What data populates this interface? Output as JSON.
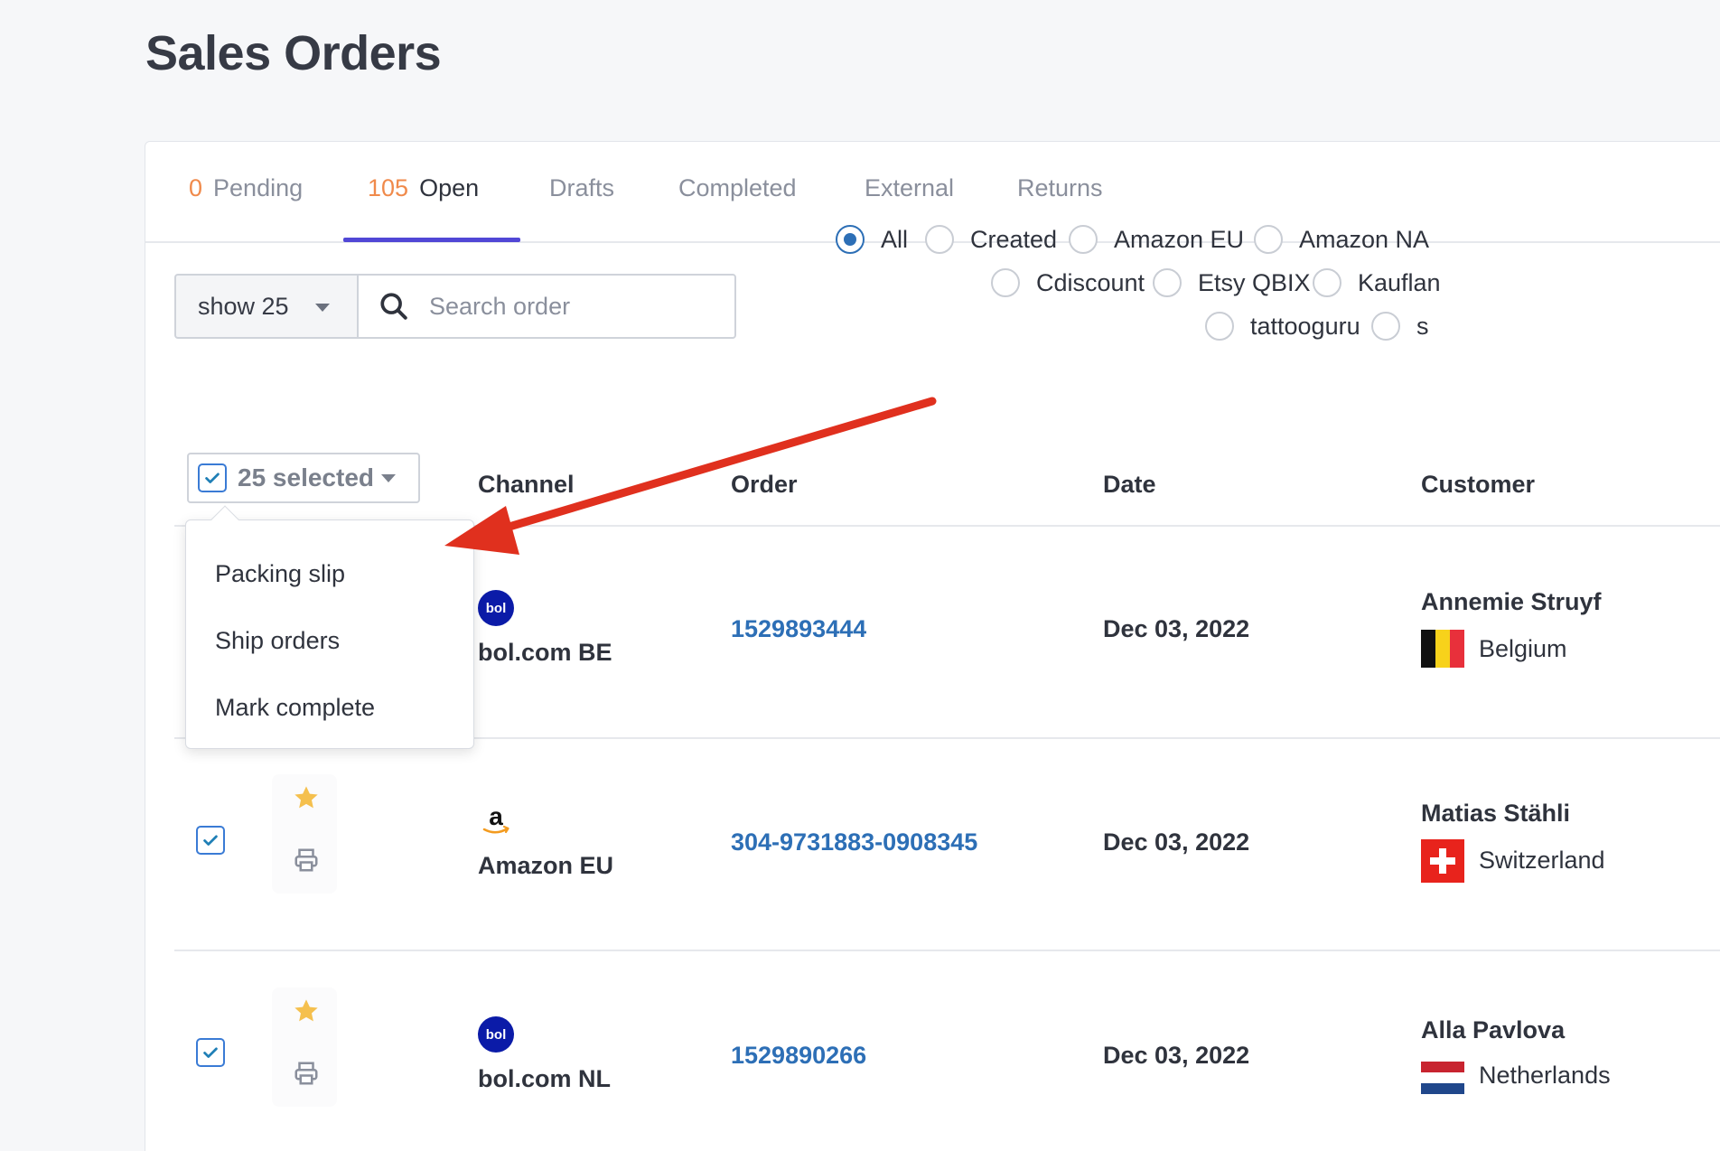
{
  "page": {
    "title": "Sales Orders"
  },
  "tabs": [
    {
      "count": "0",
      "label": "Pending"
    },
    {
      "count": "105",
      "label": "Open"
    },
    {
      "label": "Drafts"
    },
    {
      "label": "Completed"
    },
    {
      "label": "External"
    },
    {
      "label": "Returns"
    }
  ],
  "toolbar": {
    "show_select": "show 25",
    "search_placeholder": "Search order"
  },
  "filters": [
    {
      "label": "All",
      "checked": true
    },
    {
      "label": "Created"
    },
    {
      "label": "Amazon EU"
    },
    {
      "label": "Amazon NA"
    },
    {
      "label": "Cdiscount"
    },
    {
      "label": "Etsy QBIX"
    },
    {
      "label": "Kauflan"
    },
    {
      "label": "tattooguru"
    },
    {
      "label": "s"
    }
  ],
  "table": {
    "selected_label": "25 selected",
    "headers": {
      "channel": "Channel",
      "order": "Order",
      "date": "Date",
      "customer": "Customer"
    }
  },
  "bulk_menu": [
    "Packing slip",
    "Ship orders",
    "Mark complete"
  ],
  "rows": [
    {
      "channel": "bol.com BE",
      "channel_icon": "bol-logo-icon",
      "order": "1529893444",
      "date": "Dec 03, 2022",
      "customer": "Annemie Struyf",
      "country": "Belgium",
      "flag": "belgium-flag-icon"
    },
    {
      "channel": "Amazon EU",
      "channel_icon": "amazon-logo-icon",
      "order": "304-9731883-0908345",
      "date": "Dec 03, 2022",
      "customer": "Matias Stähli",
      "country": "Switzerland",
      "flag": "switzerland-flag-icon"
    },
    {
      "channel": "bol.com NL",
      "channel_icon": "bol-logo-icon",
      "order": "1529890266",
      "date": "Dec 03, 2022",
      "customer": "Alla Pavlova",
      "country": "Netherlands",
      "flag": "netherlands-flag-icon"
    }
  ],
  "colors": {
    "accent": "#5147d6",
    "count": "#f08a4b",
    "link": "#2d6fb6",
    "annotation_arrow": "#e0301e",
    "star": "#f5c04e"
  },
  "logos": {
    "bol": "bol"
  },
  "icons": {
    "search": "search-icon",
    "caret": "chevron-down-icon",
    "star": "star-icon",
    "print": "printer-icon",
    "check": "check-icon"
  }
}
